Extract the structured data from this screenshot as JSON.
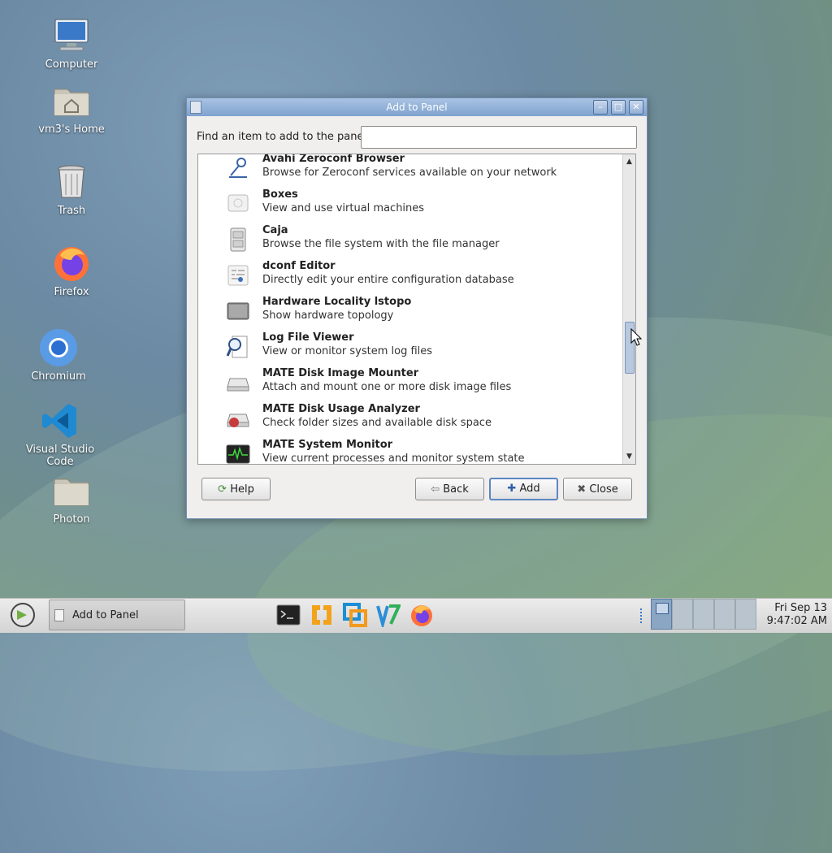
{
  "desktop": {
    "icons": [
      {
        "label": "Computer",
        "icon": "computer-icon"
      },
      {
        "label": "vm3's Home",
        "icon": "home-folder-icon"
      },
      {
        "label": "Trash",
        "icon": "trash-icon"
      },
      {
        "label": "Firefox",
        "icon": "firefox-icon"
      },
      {
        "label": "Chromium",
        "icon": "chromium-icon"
      },
      {
        "label": "Visual Studio Code",
        "icon": "vscode-icon"
      },
      {
        "label": "Photon",
        "icon": "folder-icon"
      }
    ]
  },
  "dialog": {
    "title": "Add to Panel",
    "find_label": "Find an item to add to the panel:",
    "find_value": "",
    "items": [
      {
        "name": "Avahi Zeroconf Browser",
        "desc": "Browse for Zeroconf services available on your network",
        "icon": "network-icon"
      },
      {
        "name": "Boxes",
        "desc": "View and use virtual machines",
        "icon": "boxes-icon"
      },
      {
        "name": "Caja",
        "desc": "Browse the file system with the file manager",
        "icon": "file-cabinet-icon"
      },
      {
        "name": "dconf Editor",
        "desc": "Directly edit your entire configuration database",
        "icon": "dconf-icon"
      },
      {
        "name": "Hardware Locality lstopo",
        "desc": "Show hardware topology",
        "icon": "hardware-icon"
      },
      {
        "name": "Log File Viewer",
        "desc": "View or monitor system log files",
        "icon": "log-viewer-icon"
      },
      {
        "name": "MATE Disk Image Mounter",
        "desc": "Attach and mount one or more disk image files",
        "icon": "disk-image-icon"
      },
      {
        "name": "MATE Disk Usage Analyzer",
        "desc": "Check folder sizes and available disk space",
        "icon": "disk-usage-icon"
      },
      {
        "name": "MATE System Monitor",
        "desc": "View current processes and monitor system state",
        "icon": "system-monitor-icon"
      }
    ],
    "buttons": {
      "help": "Help",
      "back": "Back",
      "add": "Add",
      "close": "Close"
    }
  },
  "taskbar": {
    "task_label": "Add to Panel",
    "clock_date": "Fri Sep 13",
    "clock_time": "9:47:02 AM"
  }
}
